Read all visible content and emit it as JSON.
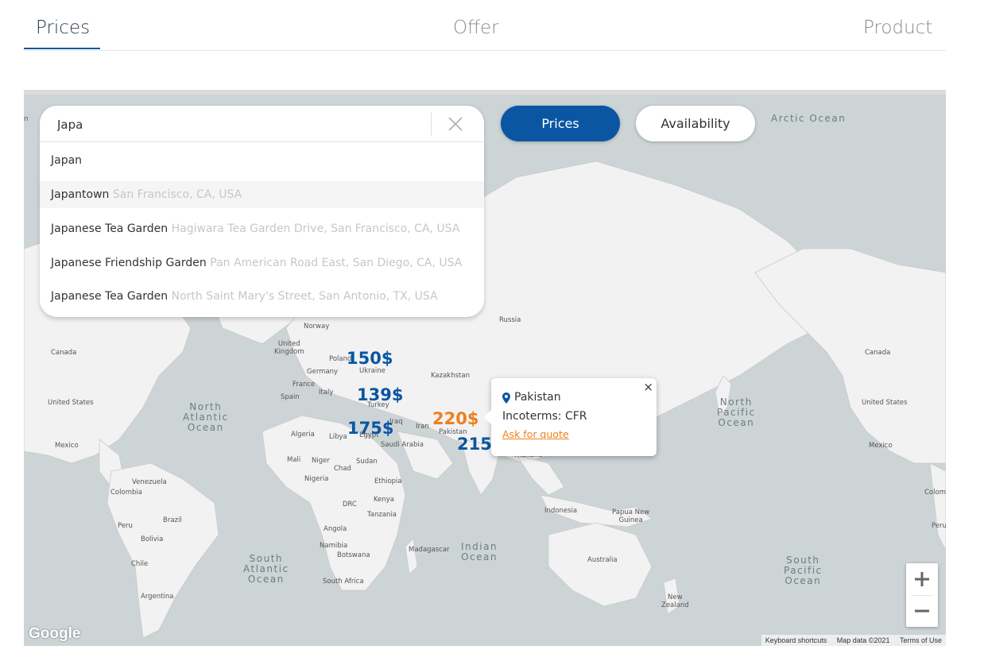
{
  "tabs": [
    {
      "label": "Prices",
      "active": true
    },
    {
      "label": "Offer",
      "active": false
    },
    {
      "label": "Product",
      "active": false
    }
  ],
  "search": {
    "value": "Japa",
    "placeholder": "",
    "suggestions": [
      {
        "main": "Japan",
        "sub": ""
      },
      {
        "main": "Japantown",
        "sub": "San Francisco, CA, USA"
      },
      {
        "main": "Japanese Tea Garden",
        "sub": "Hagiwara Tea Garden Drive, San Francisco, CA, USA"
      },
      {
        "main": "Japanese Friendship Garden",
        "sub": "Pan American Road East, San Diego, CA, USA"
      },
      {
        "main": "Japanese Tea Garden",
        "sub": "North Saint Mary's Street, San Antonio, TX, USA"
      }
    ]
  },
  "toggle": {
    "prices": "Prices",
    "availability": "Availability",
    "active": "Prices"
  },
  "prices": [
    {
      "label": "150$",
      "highlight": false
    },
    {
      "label": "139$",
      "highlight": false
    },
    {
      "label": "175$",
      "highlight": false
    },
    {
      "label": "220$",
      "highlight": true
    },
    {
      "label": "215$",
      "highlight": false
    }
  ],
  "popup": {
    "country": "Pakistan",
    "incoterms": "Incoterms: CFR",
    "link": "Ask for quote",
    "close": "×"
  },
  "map_labels": {
    "oceans": {
      "arctic": "Arctic Ocean",
      "north_atlantic": "North\nAtlantic\nOcean",
      "south_atlantic": "South\nAtlantic\nOcean",
      "indian": "Indian\nOcean",
      "north_pacific": "North\nPacific\nOcean",
      "south_pacific": "South\nPacific\nOcean"
    },
    "countries": {
      "russia": "Russia",
      "norway": "Norway",
      "united_kingdom": "United\nKingdom",
      "poland": "Poland",
      "ukraine": "Ukraine",
      "germany": "Germany",
      "france": "France",
      "spain": "Spain",
      "italy": "Italy",
      "turkey": "Turkey",
      "kazakhstan": "Kazakhstan",
      "iraq": "Iraq",
      "iran": "Iran",
      "pakistan": "Pakistan",
      "saudi_arabia": "Saudi Arabia",
      "egypt": "Egypt",
      "libya": "Libya",
      "algeria": "Algeria",
      "mali": "Mali",
      "niger": "Niger",
      "chad": "Chad",
      "sudan": "Sudan",
      "nigeria": "Nigeria",
      "ethiopia": "Ethiopia",
      "drc": "DRC",
      "kenya": "Kenya",
      "tanzania": "Tanzania",
      "angola": "Angola",
      "namibia": "Namibia",
      "botswana": "Botswana",
      "madagascar": "Madagascar",
      "south_africa": "South Africa",
      "canada_left": "Canada",
      "canada_right": "Canada",
      "us_left": "United States",
      "us_right": "United States",
      "mexico_left": "Mexico",
      "mexico_right": "Mexico",
      "venezuela": "Venezuela",
      "colombia": "Colombia",
      "colombia_right": "Colom",
      "peru": "Peru",
      "peru_right": "Peru",
      "brazil": "Brazil",
      "bolivia": "Bolivia",
      "chile": "Chile",
      "argentina": "Argentina",
      "thailand": "Thailand",
      "indonesia": "Indonesia",
      "papua_new_guinea": "Papua New\nGuinea",
      "australia": "Australia",
      "new_zealand": "New\nZealand",
      "edge_left": "n"
    }
  },
  "map_footer": {
    "google": "Google",
    "shortcuts": "Keyboard shortcuts",
    "map_data": "Map data ©2021",
    "terms": "Terms of Use"
  },
  "zoom": {
    "in": "+",
    "out": "−"
  },
  "colors": {
    "accent": "#0a56a3",
    "highlight": "#f07e1c",
    "water": "#cdd4d6",
    "land": "#f2f2f2"
  }
}
